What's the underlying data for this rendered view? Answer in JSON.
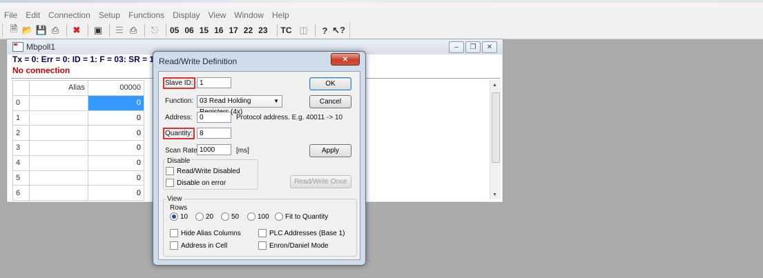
{
  "menu": [
    "File",
    "Edit",
    "Connection",
    "Setup",
    "Functions",
    "Display",
    "View",
    "Window",
    "Help"
  ],
  "toolbar": {
    "icons": [
      "new-file-icon",
      "open-folder-icon",
      "save-icon",
      "print-icon",
      "delete-icon",
      "window-icon",
      "list-icon",
      "printer-queue-icon",
      "pulse-icon"
    ],
    "function_codes": [
      "05",
      "06",
      "15",
      "16",
      "17",
      "22",
      "23"
    ],
    "tc_label": "TC",
    "help_icons": [
      "help-icon",
      "context-help-icon"
    ]
  },
  "child_window": {
    "title": "Mbpoll1",
    "status": "Tx = 0: Err = 0: ID = 1: F = 03: SR = 100",
    "connection": "No connection",
    "grid": {
      "headers": [
        "",
        "Alias",
        "00000"
      ],
      "rows": [
        {
          "n": "0",
          "alias": "",
          "value": "0"
        },
        {
          "n": "1",
          "alias": "",
          "value": "0"
        },
        {
          "n": "2",
          "alias": "",
          "value": "0"
        },
        {
          "n": "3",
          "alias": "",
          "value": "0"
        },
        {
          "n": "4",
          "alias": "",
          "value": "0"
        },
        {
          "n": "5",
          "alias": "",
          "value": "0"
        },
        {
          "n": "6",
          "alias": "",
          "value": "0"
        }
      ]
    }
  },
  "dialog": {
    "title": "Read/Write Definition",
    "slave_id_label": "Slave ID:",
    "slave_id_value": "1",
    "ok": "OK",
    "function_label": "Function:",
    "function_value": "03 Read Holding Registers (4x)",
    "cancel": "Cancel",
    "address_label": "Address:",
    "address_value": "0",
    "address_hint": "Protocol address. E.g. 40011 -> 10",
    "quantity_label": "Quantity:",
    "quantity_value": "8",
    "scan_rate_label": "Scan Rate:",
    "scan_rate_value": "1000",
    "scan_rate_unit": "[ms]",
    "apply": "Apply",
    "disable_title": "Disable",
    "rw_disabled": "Read/Write Disabled",
    "disable_on_error": "Disable on error",
    "rw_once": "Read/Write Once",
    "view_title": "View",
    "rows_title": "Rows",
    "rows_options": [
      "10",
      "20",
      "50",
      "100",
      "Fit to Quantity"
    ],
    "rows_selected": "10",
    "hide_alias": "Hide Alias Columns",
    "plc_addresses": "PLC Addresses (Base 1)",
    "address_in_cell": "Address in Cell",
    "enron_mode": "Enron/Daniel Mode"
  }
}
